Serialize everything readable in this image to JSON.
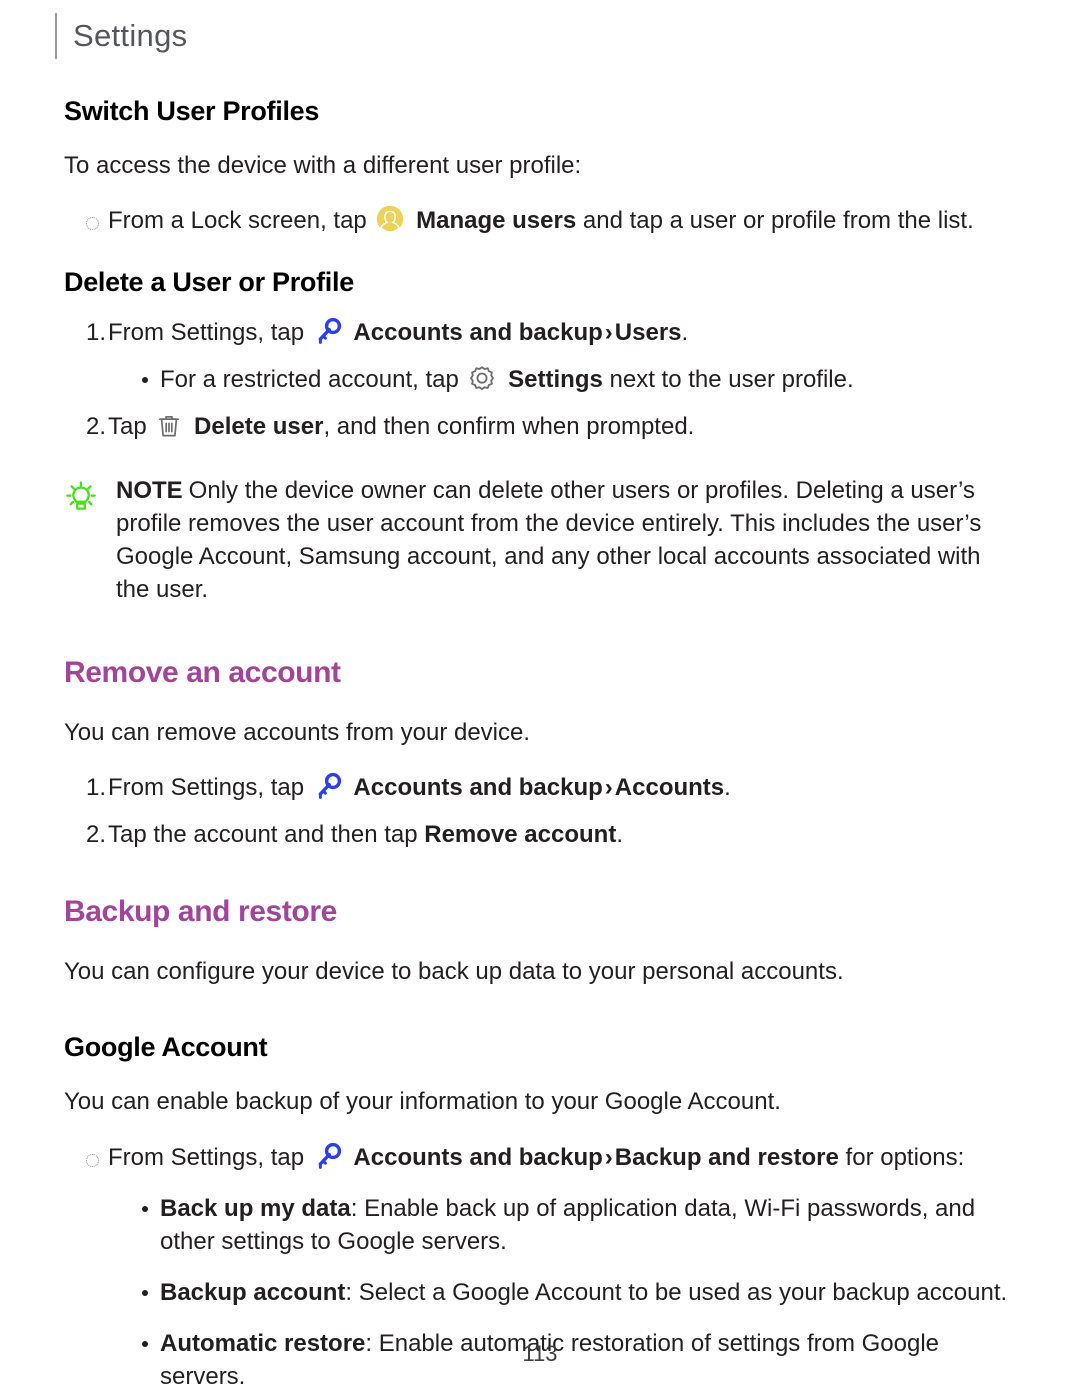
{
  "header": {
    "title": "Settings"
  },
  "colors": {
    "section_heading": "#A1459A",
    "body_text": "#231f20",
    "header_text": "#55565a",
    "key_icon": "#2B3FEE",
    "user_icon": "#EDD25A",
    "gear_icon": "#6b6b6b",
    "trash_icon": "#6b6b6b",
    "bulb_icon": "#4CDE1E"
  },
  "sections": {
    "switch_user_profiles": {
      "heading": "Switch User Profiles",
      "intro": "To access the device with a different user profile:",
      "bullet": {
        "before": "From a Lock screen, tap",
        "icon": "manage-users-icon",
        "bold": "Manage users",
        "after": "and tap a user or profile from the list."
      }
    },
    "delete_user_or_profile": {
      "heading": "Delete a User or Profile",
      "steps": [
        {
          "number": "1.",
          "before": "From Settings, tap",
          "icon": "key-icon",
          "bold1": "Accounts and backup",
          "chevron": "›",
          "bold2": "Users",
          "after": "."
        },
        {
          "number": "2.",
          "before": "Tap",
          "icon": "trash-icon",
          "bold1": "Delete user",
          "after": ", and then confirm when prompted."
        }
      ],
      "substep": {
        "before": "For a restricted account, tap",
        "icon": "gear-icon",
        "bold": "Settings",
        "after": "next to the user profile."
      }
    },
    "note": {
      "icon": "lightbulb-icon",
      "label": "NOTE",
      "text": "Only the device owner can delete other users or profiles. Deleting a user’s profile removes the user account from the device entirely. This includes the user’s Google Account, Samsung account, and any other local accounts associated with the user."
    },
    "remove_an_account": {
      "heading": "Remove an account",
      "intro": "You can remove accounts from your device.",
      "steps": [
        {
          "number": "1.",
          "before": "From Settings, tap",
          "icon": "key-icon",
          "bold1": "Accounts and backup",
          "chevron": "›",
          "bold2": "Accounts",
          "after": "."
        },
        {
          "number": "2.",
          "before": "Tap the account and then tap",
          "bold1": "Remove account",
          "after": "."
        }
      ]
    },
    "backup_and_restore": {
      "heading": "Backup and restore",
      "intro": "You can configure your device to back up data to your personal accounts."
    },
    "google_account": {
      "heading": "Google Account",
      "intro": "You can enable backup of your information to your Google Account.",
      "bullet": {
        "before": "From Settings, tap",
        "icon": "key-icon",
        "bold1": "Accounts and backup",
        "chevron": "›",
        "bold2": "Backup and restore",
        "after": "for options:"
      },
      "options": [
        {
          "bold": "Back up my data",
          "text": ": Enable back up of application data, Wi-Fi passwords, and other settings to Google servers."
        },
        {
          "bold": "Backup account",
          "text": ": Select a Google Account to be used as your backup account."
        },
        {
          "bold": "Automatic restore",
          "text": ": Enable automatic restoration of settings from Google servers."
        }
      ]
    }
  },
  "footer": {
    "page_number": "113"
  }
}
